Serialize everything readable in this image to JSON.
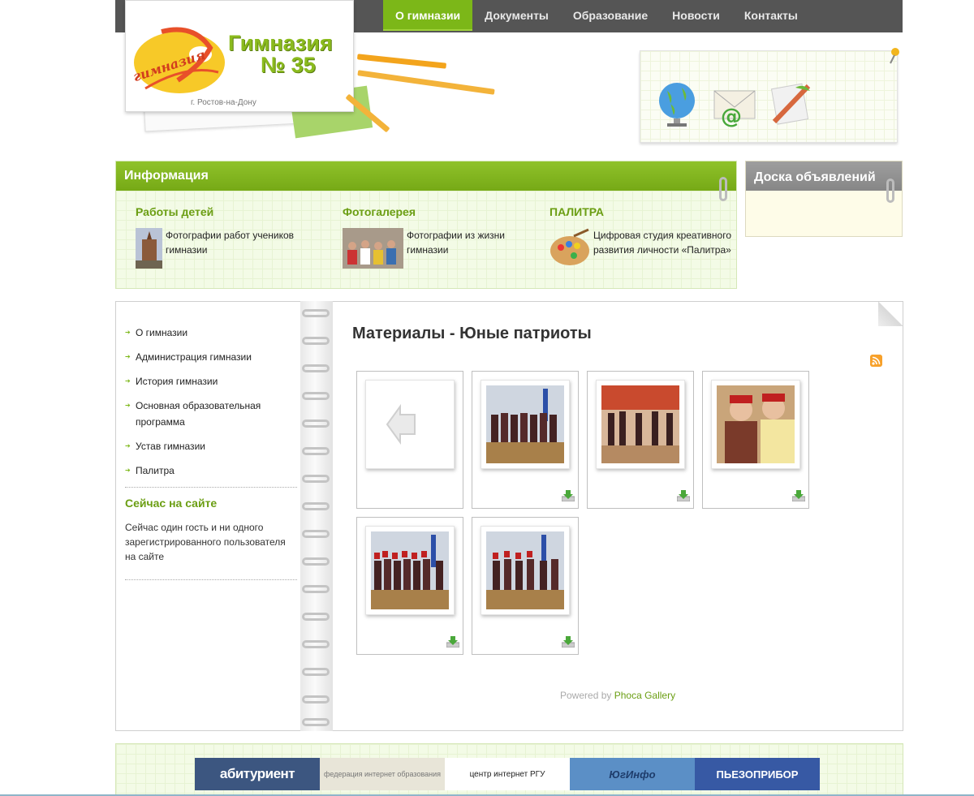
{
  "nav": {
    "items": [
      {
        "label": "О гимназии",
        "active": true
      },
      {
        "label": "Документы",
        "active": false
      },
      {
        "label": "Образование",
        "active": false
      },
      {
        "label": "Новости",
        "active": false
      },
      {
        "label": "Контакты",
        "active": false
      }
    ]
  },
  "logo": {
    "script_text": "гимназия",
    "title": "Гимназия",
    "number": "№ 35",
    "city": "г. Ростов-на-Дону"
  },
  "header_icons": [
    "globe-icon",
    "mail-icon",
    "pencil-edit-icon"
  ],
  "info": {
    "title": "Информация",
    "columns": [
      {
        "heading": "Работы детей",
        "text": "Фотографии работ учеников гимназии"
      },
      {
        "heading": "Фотогалерея",
        "text": "Фотографии из жизни гимназии"
      },
      {
        "heading": "ПАЛИТРА",
        "text": "Цифровая студия креативного развития личности «Палитра»"
      }
    ]
  },
  "board": {
    "title": "Доска объявлений"
  },
  "sidebar": {
    "menu": [
      {
        "label": "О гимназии"
      },
      {
        "label": "Администрация гимназии"
      },
      {
        "label": "История гимназии"
      },
      {
        "label": "Основная образовательная программа"
      },
      {
        "label": "Устав гимназии"
      },
      {
        "label": "Палитра"
      }
    ],
    "online_title": "Сейчас на сайте",
    "online_text": "Сейчас один гость и ни одного зарегистрированного пользователя на сайте"
  },
  "gallery": {
    "title": "Материалы - Юные патриоты",
    "powered_prefix": "Powered by",
    "powered_link": "Phoca Gallery",
    "items": [
      {
        "type": "back"
      },
      {
        "type": "photo"
      },
      {
        "type": "photo"
      },
      {
        "type": "photo"
      },
      {
        "type": "photo"
      },
      {
        "type": "photo"
      }
    ]
  },
  "footer": {
    "banners": [
      {
        "label": "абитуриент"
      },
      {
        "label": "федерация интернет образования"
      },
      {
        "label": "центр интернет РГУ"
      },
      {
        "label": "ЮгИнфо"
      },
      {
        "label": "ПЬЕЗОПРИБОР"
      }
    ]
  },
  "colors": {
    "accent_green": "#7cb718",
    "nav_bg": "#555555",
    "board_grey": "#8e8e8e"
  }
}
